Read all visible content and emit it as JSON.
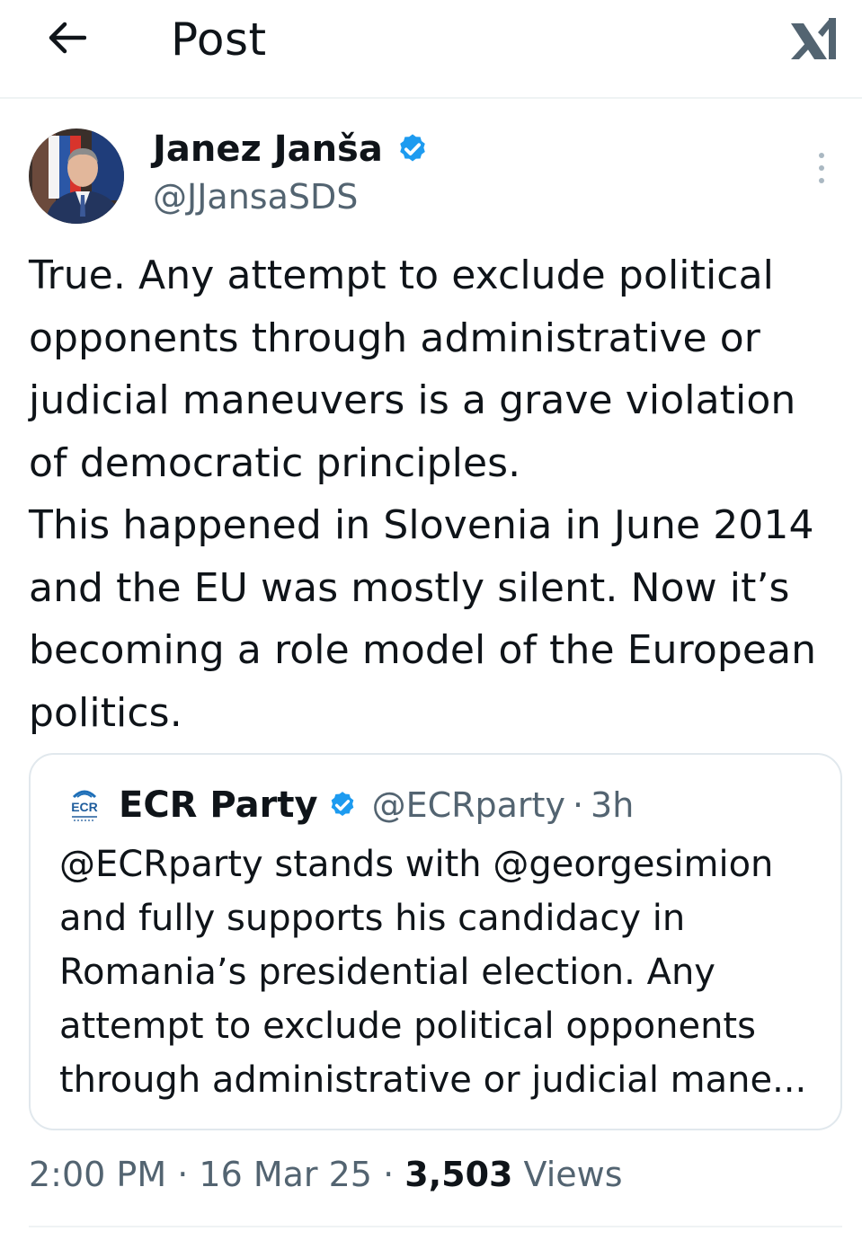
{
  "header": {
    "title": "Post",
    "back_icon": "arrow-left-icon",
    "brand_icon": "x-logo-icon"
  },
  "post": {
    "author_name": "Janez Janša",
    "author_handle": "@JJansaSDS",
    "verified_icon": "verified-badge-icon",
    "more_icon": "more-vertical-icon",
    "text": "True. Any attempt to exclude political opponents through administrative or judicial maneuvers is a grave violation of democratic principles.\nThis happened in Slovenia in June 2014 and the EU was mostly silent. Now it’s becoming a role model of the European politics."
  },
  "quote": {
    "author_name": "ECR Party",
    "author_handle": "@ECRparty",
    "separator": "·",
    "time": "3h",
    "text": "@ECRparty stands with @georgesimion and fully supports his candidacy in Romania’s presidential election. Any attempt to exclude political opponents through administrative or judicial mane..."
  },
  "meta": {
    "time": "2:00 PM",
    "separator": "·",
    "date": "16 Mar 25",
    "views_count": "3,503",
    "views_label": "Views"
  },
  "colors": {
    "text": "#0f1419",
    "secondary": "#536471",
    "verified": "#1d9bf0",
    "border": "#e1e8ed"
  }
}
